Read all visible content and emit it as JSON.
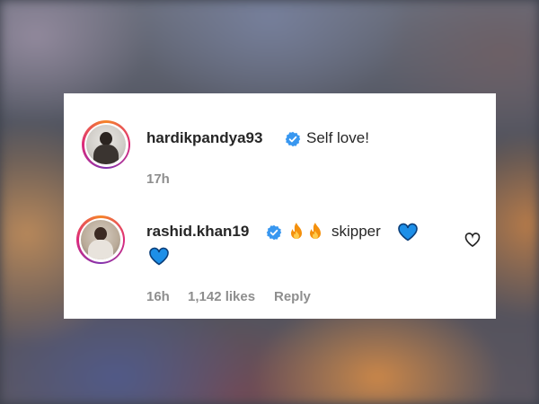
{
  "comments": [
    {
      "username": "hardikpandya93",
      "text": "Self love!",
      "time": "17h"
    },
    {
      "username": "rashid.khan19",
      "text": "skipper",
      "time": "16h",
      "likes": "1,142 likes",
      "reply_label": "Reply"
    }
  ],
  "colors": {
    "verified": "#3897f0",
    "blue_heart": "#1da1f2",
    "meta_text": "#8e8e8e"
  },
  "icons": [
    "verified-badge-icon",
    "fire-emoji-icon",
    "blue-heart-emoji-icon",
    "like-heart-icon"
  ]
}
